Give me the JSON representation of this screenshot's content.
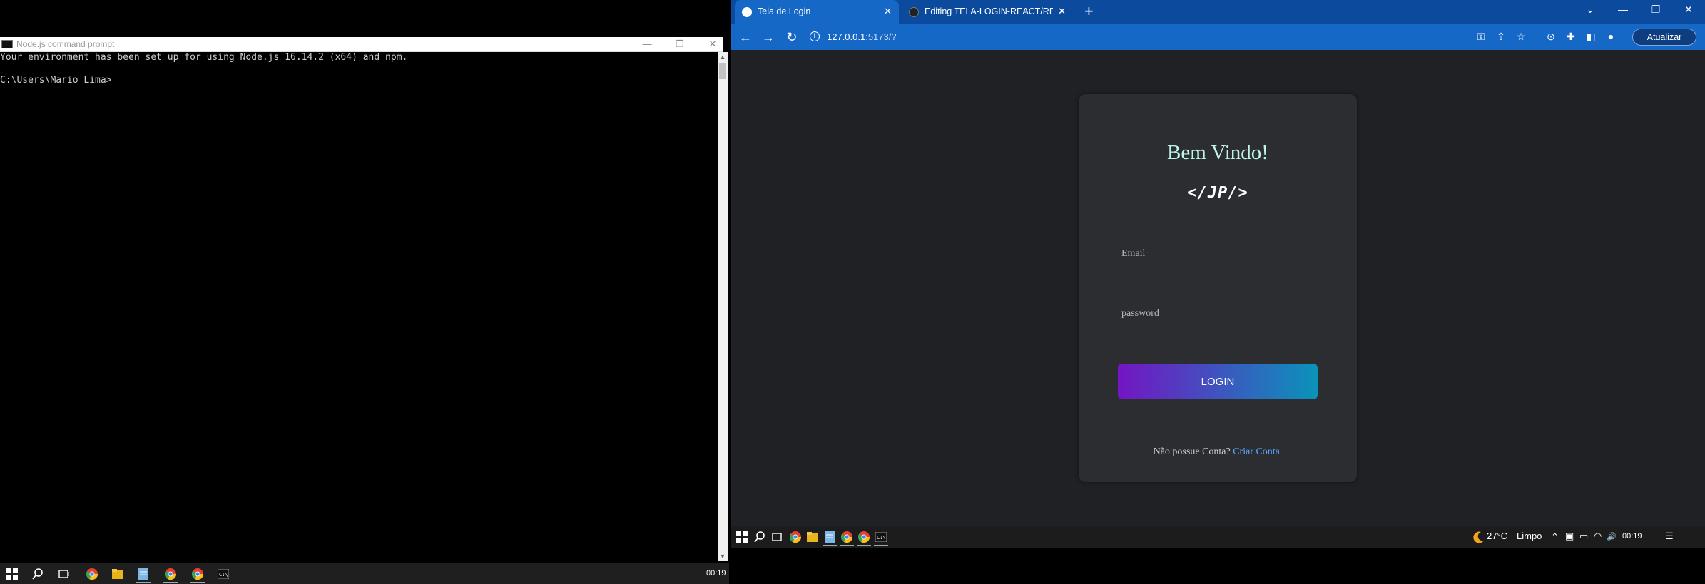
{
  "cmd": {
    "title": "Node.js command prompt",
    "minimize": "—",
    "maximize": "❐",
    "close": "✕",
    "lines": [
      "Your environment has been set up for using Node.js 16.14.2 (x64) and npm.",
      "",
      "C:\\Users\\Mario Lima>"
    ]
  },
  "left_taskbar": {
    "clock": "00:19",
    "icons": [
      "windows-start-icon",
      "search-icon",
      "task-view-icon",
      "chrome-icon",
      "file-explorer-icon",
      "notepad-icon",
      "chrome-icon",
      "chrome-icon",
      "terminal-icon"
    ]
  },
  "browser": {
    "tabs": [
      {
        "label": "Tela de Login",
        "active": true
      },
      {
        "label": "Editing TELA-LOGIN-REACT/README",
        "active": false
      }
    ],
    "new_tab": "+",
    "window_controls": {
      "tabsearch": "⌄",
      "minimize": "—",
      "restore": "❐",
      "close": "✕"
    },
    "nav": {
      "back": "←",
      "forward": "→",
      "reload": "↻"
    },
    "url_host": "127.0.0.1",
    "url_rest": ":5173/?",
    "info_icon": "i",
    "toolbar_icons": {
      "key": "⚿",
      "share": "⇪",
      "star": "☆",
      "extension": "✚",
      "sidepanel": "◧",
      "profile": "●"
    },
    "update_button": "Atualizar"
  },
  "login": {
    "title": "Bem Vindo!",
    "logo": "</JP/>",
    "email_placeholder": "Email",
    "password_placeholder": "password",
    "button": "LOGIN",
    "no_account": "Não possue Conta?",
    "create_account": "Criar Conta."
  },
  "right_taskbar": {
    "temperature": "27°C",
    "weather": "Limpo",
    "clock": "00:19",
    "tray": {
      "chevron": "⌃",
      "volume": "🔊",
      "notifications": "☰"
    }
  },
  "colors": {
    "tab_strip": "#0b4a9c",
    "toolbar": "#1668c7",
    "card_bg": "#2b2d30",
    "title_color": "#bff4ec",
    "gradient_start": "#7415c3",
    "gradient_end": "#0a93ba",
    "link": "#5aa7ff"
  }
}
